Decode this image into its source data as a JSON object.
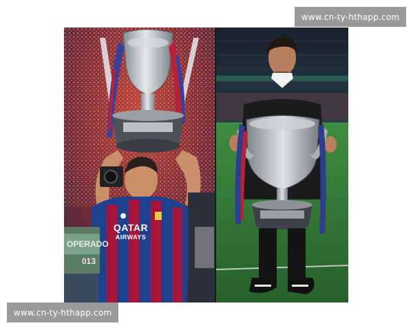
{
  "watermark": {
    "top_text": "www.cn-ty-hthapp.com",
    "bottom_text": "www.cn-ty-hthapp.com"
  },
  "photo": {
    "left_panel": {
      "shirt_sponsor": "QATAR",
      "shirt_sponsor_sub": "AIRWAYS",
      "board_text_1": "OPERADO",
      "board_text_2": "013"
    }
  },
  "colors": {
    "watermark_bg": "#9a9a9a",
    "barca_blue": "#1f3f8f",
    "barca_red": "#a3163a",
    "pitch_green": "#2f7a36",
    "trophy_silver": "#b9bdc0"
  }
}
